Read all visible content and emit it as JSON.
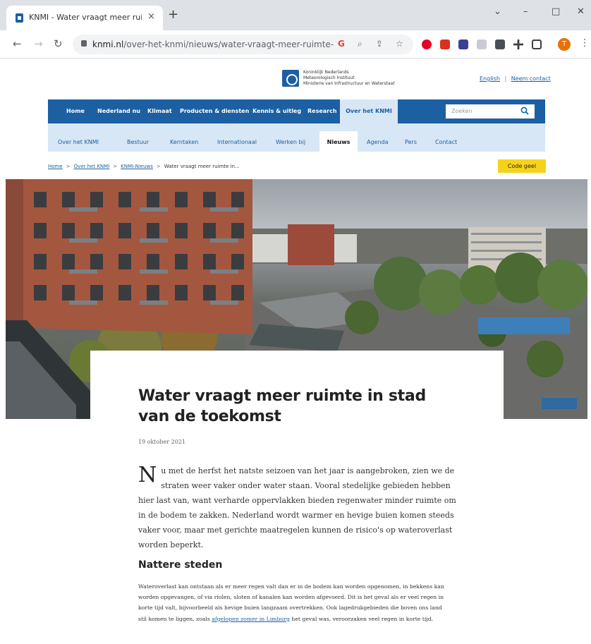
{
  "browser": {
    "tab_title": "KNMI - Water vraagt meer ruimte",
    "tab_close": "×",
    "new_tab": "+",
    "window_controls": [
      "⌄",
      "–",
      "□",
      "✕"
    ],
    "back": "←",
    "forward": "→",
    "reload": "↻",
    "url_domain": "knmi.nl",
    "url_path": "/over-het-knmi/nieuws/water-vraagt-meer-ruimte-i...",
    "omnibox_icons": [
      "G",
      "⌕",
      "⇪",
      "☆"
    ],
    "profile_initial": "T",
    "menu": "⋮"
  },
  "site": {
    "org_lines": [
      "Koninklijk Nederlands",
      "Meteorologisch Instituut",
      "Ministerie van Infrastructuur en Waterstaat"
    ],
    "link_english": "English",
    "link_separator": "|",
    "link_contact": "Neem contact",
    "main_nav": [
      "Home",
      "Nederland nu",
      "Klimaat",
      "Producten & diensten",
      "Kennis & uitleg",
      "Research"
    ],
    "main_nav_active": "Over het KNMI",
    "search_placeholder": "Zoeken",
    "sub_nav": [
      "Over het KNMI",
      "Bestuur",
      "Kerntaken",
      "Internationaal",
      "Werken bij"
    ],
    "sub_nav_active": "Nieuws",
    "sub_nav_after": [
      "Agenda",
      "Pers",
      "Contact"
    ],
    "breadcrumb": [
      "Home",
      "Over het KNMI",
      "KNMI-Nieuws",
      "Water vraagt meer ruimte in..."
    ],
    "breadcrumb_sep": ">",
    "code_button": "Code geel"
  },
  "article": {
    "title": "Water vraagt meer ruimte in stad van de toekomst",
    "date": "19 oktober 2021",
    "lead_dropcap": "N",
    "lead": "u met de herfst het natste seizoen van het jaar is aangebroken, zien we de straten weer vaker onder water staan. Vooral stedelijke gebieden hebben hier last van, want verharde oppervlakken bieden regenwater minder ruimte om in de bodem te zakken. Nederland wordt warmer en hevige buien komen steeds vaker voor, maar met gerichte maatregelen kunnen de risico's op wateroverlast worden beperkt.",
    "section_heading": "Nattere steden",
    "body_text": "Wateroverlast kan ontstaan als er meer regen valt dan er in de bodem kan worden opgenomen, in bekkens kan worden opgevangen, of via riolen, sloten of kanalen kan worden afgevoerd. Dit is het geval als er veel regen in korte tijd valt, bijvoorbeeld als hevige buien langzaam overtrekken. Ook lagedrukgebieden die boven ons land stil komen te liggen, zoals",
    "body_link": "afgelopen zomer in Limburg",
    "body_tail": "het geval was, veroorzaken veel regen in korte tijd."
  },
  "colors": {
    "brand_blue": "#1c5fa3",
    "sub_nav_bg": "#d7e7f5",
    "code_yellow": "#f6d31a",
    "profile_orange": "#e8710a"
  }
}
